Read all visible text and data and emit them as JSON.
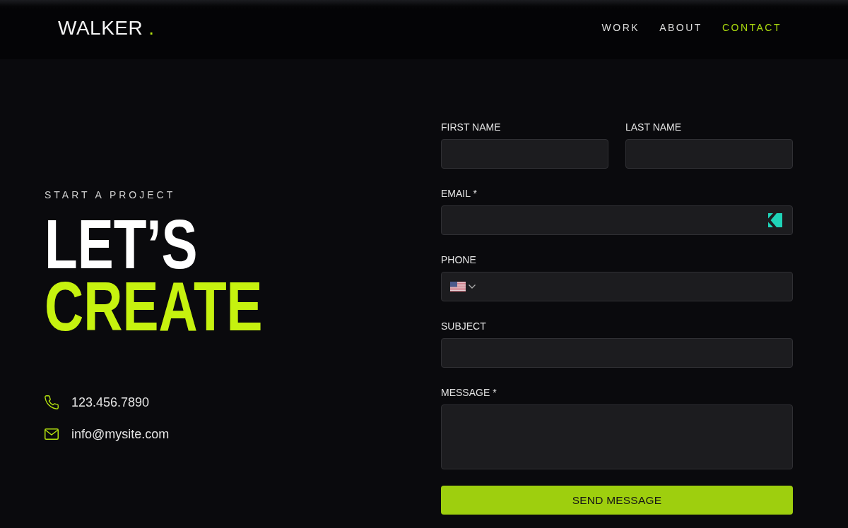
{
  "header": {
    "logo": "WALKER",
    "logo_mark": ".",
    "nav": [
      {
        "label": "WORK",
        "selected": false
      },
      {
        "label": "ABOUT",
        "selected": false
      },
      {
        "label": "CONTACT",
        "selected": true
      }
    ]
  },
  "hero": {
    "eyebrow": "START A PROJECT",
    "headline": [
      "LET’S",
      "CREATE"
    ],
    "contacts": [
      {
        "kind": "phone",
        "text": "123.456.7890"
      },
      {
        "kind": "email",
        "text": "info@mysite.com"
      }
    ]
  },
  "form": {
    "rows": [
      {
        "fields": [
          {
            "label": "FIRST NAME",
            "kind": "text"
          },
          {
            "label": "LAST NAME",
            "kind": "text"
          }
        ]
      },
      {
        "fields": [
          {
            "label": "EMAIL *",
            "kind": "email"
          }
        ]
      },
      {
        "fields": [
          {
            "label": "PHONE",
            "kind": "phone"
          }
        ]
      },
      {
        "fields": [
          {
            "label": "SUBJECT",
            "kind": "text"
          }
        ]
      },
      {
        "fields": [
          {
            "label": "MESSAGE *",
            "kind": "textarea"
          }
        ]
      }
    ],
    "button": "SEND MESSAGE"
  }
}
